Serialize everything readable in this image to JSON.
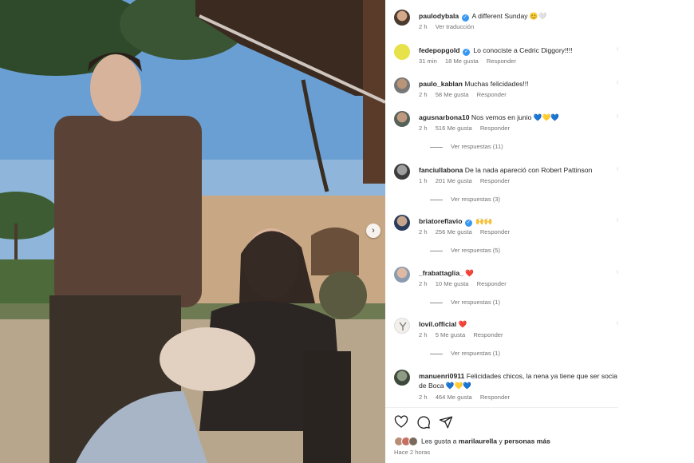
{
  "colors": {
    "verified": "#3897f0",
    "muted": "#737373",
    "text": "#262626",
    "heart": "#c8102e"
  },
  "photo": {
    "next_icon": "chevron-right-icon",
    "next_glyph": "›"
  },
  "comments": [
    {
      "user": "paulodybala",
      "verified": true,
      "text": "A different Sunday 😊🤍",
      "time": "2 h",
      "likes": "",
      "reply": "",
      "extra": "Ver traducción",
      "replies": ""
    },
    {
      "user": "fedepopgold",
      "verified": true,
      "text": "Lo conociste a Cedric Diggory!!!!",
      "time": "31 min",
      "likes": "18 Me gusta",
      "reply": "Responder",
      "extra": "",
      "replies": ""
    },
    {
      "user": "paulo_kablan",
      "verified": false,
      "text": "Muchas felicidades!!!",
      "time": "2 h",
      "likes": "58 Me gusta",
      "reply": "Responder",
      "extra": "",
      "replies": ""
    },
    {
      "user": "agusnarbona10",
      "verified": false,
      "text": "Nos vemos en junio 💙💛💙",
      "time": "2 h",
      "likes": "516 Me gusta",
      "reply": "Responder",
      "extra": "",
      "replies": "Ver respuestas (11)"
    },
    {
      "user": "fanciullabona",
      "verified": false,
      "text": "De la nada apareció con Robert Pattinson",
      "time": "1 h",
      "likes": "201 Me gusta",
      "reply": "Responder",
      "extra": "",
      "replies": "Ver respuestas (3)"
    },
    {
      "user": "briatoreflavio",
      "verified": true,
      "text": "🙌🙌",
      "time": "2 h",
      "likes": "256 Me gusta",
      "reply": "Responder",
      "extra": "",
      "replies": "Ver respuestas (5)"
    },
    {
      "user": "_frabattaglia_",
      "verified": false,
      "text": "❤️",
      "time": "2 h",
      "likes": "10 Me gusta",
      "reply": "Responder",
      "extra": "",
      "replies": "Ver respuestas (1)"
    },
    {
      "user": "lovil.official",
      "verified": false,
      "text": "❤️",
      "time": "2 h",
      "likes": "5 Me gusta",
      "reply": "Responder",
      "extra": "",
      "replies": "Ver respuestas (1)"
    },
    {
      "user": "manuenri0911",
      "verified": false,
      "text": "Felicidades chicos, la nena ya tiene que ser socia de Boca 💙💛💙",
      "time": "2 h",
      "likes": "464 Me gusta",
      "reply": "Responder",
      "extra": "",
      "replies": ""
    }
  ],
  "footer": {
    "icons": [
      "heart-icon",
      "comment-icon",
      "share-icon"
    ],
    "likes_prefix": "Les gusta a ",
    "likes_user": "marilaurella",
    "likes_mid": " y ",
    "likes_more": "personas más",
    "time_ago": "Hace 2 horas"
  }
}
